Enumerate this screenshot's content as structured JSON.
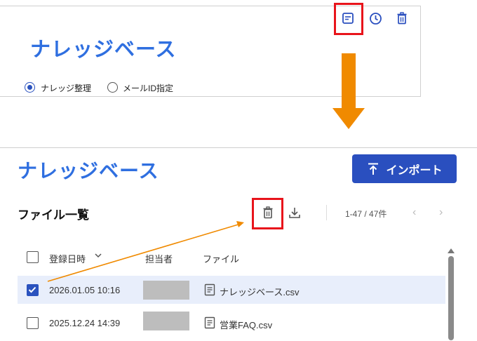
{
  "top": {
    "title": "ナレッジベース",
    "radio_options": [
      {
        "label": "ナレッジ整理",
        "selected": true
      },
      {
        "label": "メールID指定",
        "selected": false
      }
    ],
    "icons": [
      "note-icon",
      "history-icon",
      "trash-icon"
    ]
  },
  "bottom": {
    "title": "ナレッジベース",
    "import_label": "インポート",
    "list_title": "ファイル一覧",
    "pagination": "1-47 / 47件",
    "columns": {
      "date": "登録日時",
      "owner": "担当者",
      "file": "ファイル"
    },
    "rows": [
      {
        "date": "2026.01.05 10:16",
        "file": "ナレッジベース.csv",
        "checked": true
      },
      {
        "date": "2025.12.24 14:39",
        "file": "営業FAQ.csv",
        "checked": false
      }
    ]
  },
  "colors": {
    "accent": "#2a4fbf",
    "title": "#2f6fe0",
    "highlight": "#e8141b",
    "arrow": "#f08a00"
  }
}
